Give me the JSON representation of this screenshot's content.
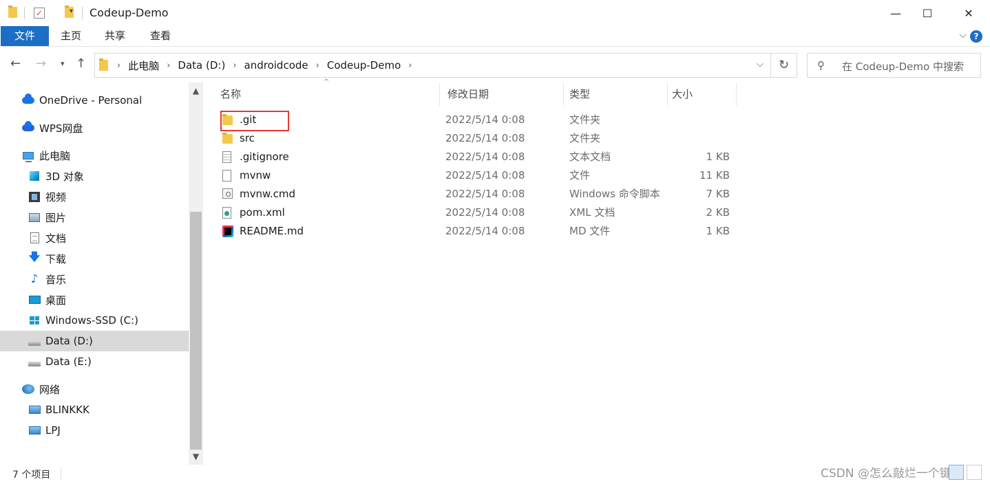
{
  "window": {
    "title": "Codeup-Demo",
    "minimize": "—",
    "maximize": "☐",
    "close": "✕"
  },
  "ribbon": {
    "tabs": [
      "文件",
      "主页",
      "共享",
      "查看"
    ]
  },
  "address": {
    "crumbs": [
      "此电脑",
      "Data (D:)",
      "androidcode",
      "Codeup-Demo"
    ],
    "search_placeholder": "在 Codeup-Demo 中搜索"
  },
  "sidebar": {
    "items": [
      {
        "label": "OneDrive - Personal",
        "icon": "onedrive-icon"
      },
      {
        "label": "WPS网盘",
        "icon": "cloud-icon"
      },
      {
        "label": "此电脑",
        "icon": "this-pc-icon"
      },
      {
        "label": "3D 对象",
        "icon": "3d-objects-icon"
      },
      {
        "label": "视频",
        "icon": "video-icon"
      },
      {
        "label": "图片",
        "icon": "pictures-icon"
      },
      {
        "label": "文档",
        "icon": "documents-icon"
      },
      {
        "label": "下载",
        "icon": "download-icon"
      },
      {
        "label": "音乐",
        "icon": "music-icon"
      },
      {
        "label": "桌面",
        "icon": "desktop-icon"
      },
      {
        "label": "Windows-SSD (C:)",
        "icon": "windows-drive-icon"
      },
      {
        "label": "Data (D:)",
        "icon": "drive-icon",
        "selected": true
      },
      {
        "label": "Data (E:)",
        "icon": "drive-icon"
      },
      {
        "label": "网络",
        "icon": "network-icon"
      },
      {
        "label": "BLINKKK",
        "icon": "computer-icon"
      },
      {
        "label": "LPJ",
        "icon": "computer-icon"
      }
    ]
  },
  "filelist": {
    "columns": [
      "名称",
      "修改日期",
      "类型",
      "大小"
    ],
    "rows": [
      {
        "name": ".git",
        "date": "2022/5/14 0:08",
        "type": "文件夹",
        "size": "",
        "icon": "folder-icon"
      },
      {
        "name": "src",
        "date": "2022/5/14 0:08",
        "type": "文件夹",
        "size": "",
        "icon": "folder-icon"
      },
      {
        "name": ".gitignore",
        "date": "2022/5/14 0:08",
        "type": "文本文档",
        "size": "1 KB",
        "icon": "text-file-icon"
      },
      {
        "name": "mvnw",
        "date": "2022/5/14 0:08",
        "type": "文件",
        "size": "11 KB",
        "icon": "file-icon"
      },
      {
        "name": "mvnw.cmd",
        "date": "2022/5/14 0:08",
        "type": "Windows 命令脚本",
        "size": "7 KB",
        "icon": "cmd-file-icon"
      },
      {
        "name": "pom.xml",
        "date": "2022/5/14 0:08",
        "type": "XML 文档",
        "size": "2 KB",
        "icon": "xml-file-icon"
      },
      {
        "name": "README.md",
        "date": "2022/5/14 0:08",
        "type": "MD 文件",
        "size": "1 KB",
        "icon": "markdown-file-icon"
      }
    ]
  },
  "status": {
    "count": "7 个项目"
  },
  "watermark": "CSDN @怎么敲烂一个键盘"
}
